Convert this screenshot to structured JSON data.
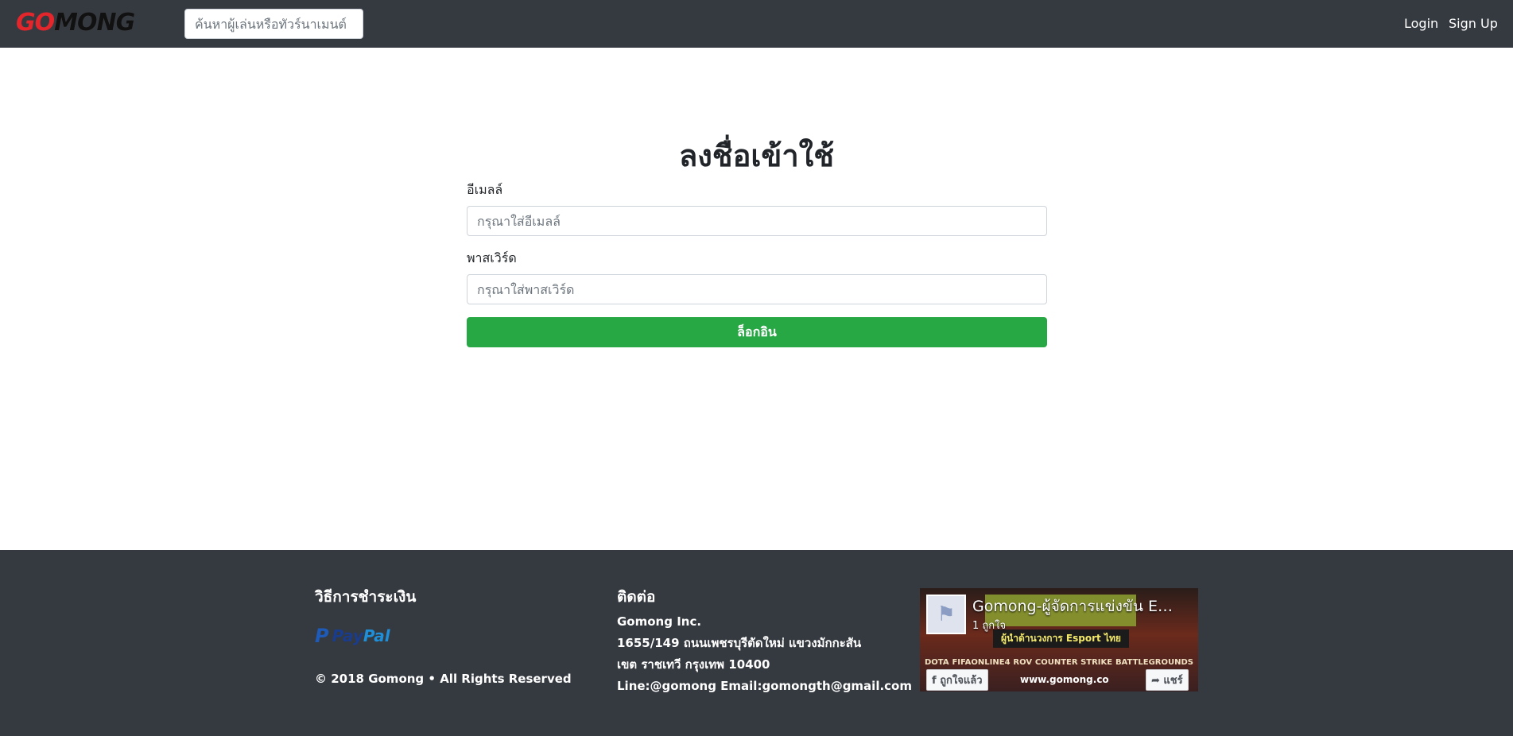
{
  "navbar": {
    "logo_part1": "GO",
    "logo_part2": "MONG",
    "search_placeholder": "ค้นหาผู้เล่นหรือทัวร์นาเมนต์",
    "login_label": "Login",
    "signup_label": "Sign Up"
  },
  "login_form": {
    "title": "ลงชื่อเข้าใช้",
    "email_label": "อีเมลล์",
    "email_placeholder": "กรุณาใส่อีเมลล์",
    "password_label": "พาสเวิร์ด",
    "password_placeholder": "กรุณาใส่พาสเวิร์ด",
    "submit_label": "ล็อกอิน"
  },
  "footer": {
    "payment_heading": "วิธีการชำระเงิน",
    "paypal_pay": "Pay",
    "paypal_pal": "Pal",
    "copyright": "© 2018 Gomong • All Rights Reserved",
    "contact_heading": "ติดต่อ",
    "contact_lines": [
      "Gomong Inc.",
      "1655/149 ถนนเพชรบุรีตัดใหม่ แขวงมักกะสัน",
      "เขต ราชเทวี กรุงเทพ 10400",
      "Line:@gomong Email:gomongth@gmail.com"
    ]
  },
  "facebook_widget": {
    "page_name": "Gomong-ผู้จัดการแข่งขัน E…",
    "likes": "1 ถูกใจ",
    "banner_tagline": "ผู้นำด้านวงการ Esport ไทย",
    "games": [
      "DOTA",
      "FIFAONLINE4",
      "ROV",
      "COUNTER STRIKE",
      "BATTLEGROUNDS"
    ],
    "like_button": "ถูกใจแล้ว",
    "share_button": "แชร์",
    "url": "www.gomong.co"
  }
}
